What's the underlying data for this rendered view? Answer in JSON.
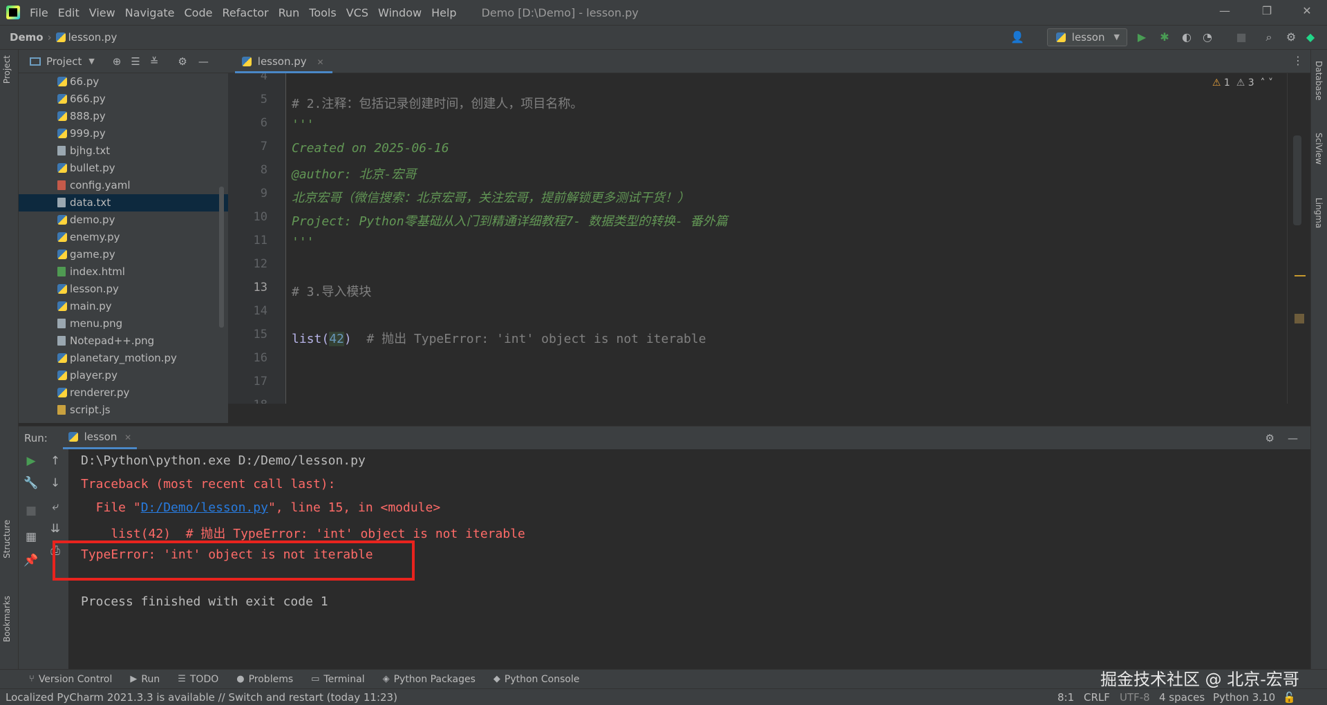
{
  "app": {
    "window_title": "Demo [D:\\Demo] - lesson.py",
    "menu": [
      "File",
      "Edit",
      "View",
      "Navigate",
      "Code",
      "Refactor",
      "Run",
      "Tools",
      "VCS",
      "Window",
      "Help"
    ]
  },
  "breadcrumb": {
    "project": "Demo",
    "file": "lesson.py"
  },
  "toolbar": {
    "run_config": "lesson"
  },
  "project_panel": {
    "title": "Project",
    "files": [
      {
        "name": "66.py",
        "type": "py"
      },
      {
        "name": "666.py",
        "type": "py"
      },
      {
        "name": "888.py",
        "type": "py"
      },
      {
        "name": "999.py",
        "type": "py"
      },
      {
        "name": "bjhg.txt",
        "type": "txt"
      },
      {
        "name": "bullet.py",
        "type": "py"
      },
      {
        "name": "config.yaml",
        "type": "yaml"
      },
      {
        "name": "data.txt",
        "type": "txt",
        "selected": true
      },
      {
        "name": "demo.py",
        "type": "py"
      },
      {
        "name": "enemy.py",
        "type": "py"
      },
      {
        "name": "game.py",
        "type": "py"
      },
      {
        "name": "index.html",
        "type": "html"
      },
      {
        "name": "lesson.py",
        "type": "py"
      },
      {
        "name": "main.py",
        "type": "py"
      },
      {
        "name": "menu.png",
        "type": "png"
      },
      {
        "name": "Notepad++.png",
        "type": "png"
      },
      {
        "name": "planetary_motion.py",
        "type": "py"
      },
      {
        "name": "player.py",
        "type": "py"
      },
      {
        "name": "renderer.py",
        "type": "py"
      },
      {
        "name": "script.js",
        "type": "js"
      }
    ]
  },
  "editor": {
    "tab": "lesson.py",
    "warnings": "1",
    "weak_warnings": "3",
    "line_numbers": [
      "4",
      "5",
      "6",
      "7",
      "8",
      "9",
      "10",
      "11",
      "12",
      "13",
      "14",
      "15",
      "16",
      "17",
      "18"
    ],
    "current_line": "13",
    "lines": {
      "l5": "# 2.注释：包括记录创建时间，创建人，项目名称。",
      "l6": "'''",
      "l7": "Created on 2025-06-16",
      "l8": "@author: 北京-宏哥",
      "l9": "北京宏哥（微信搜索：北京宏哥，关注宏哥，提前解锁更多测试干货！）",
      "l10": "Project: Python零基础从入门到精通详细教程7- 数据类型的转换- 番外篇",
      "l11": "'''",
      "l13": "# 3.导入模块",
      "l15_fn": "list(",
      "l15_num": "42",
      "l15_close": ")",
      "l15_comment": "  # 抛出 TypeError: 'int' object is not iterable"
    }
  },
  "run_panel": {
    "label": "Run:",
    "tab": "lesson",
    "output": {
      "cmd": "D:\\Python\\python.exe D:/Demo/lesson.py",
      "traceback": "Traceback (most recent call last):",
      "file_prefix": "  File \"",
      "file_link": "D:/Demo/lesson.py",
      "file_suffix": "\", line 15, in <module>",
      "code": "    list(42)  # 抛出 TypeError: 'int' object is not iterable",
      "error": "TypeError: 'int' object is not iterable",
      "finished": "Process finished with exit code 1"
    }
  },
  "bottom_tabs": [
    "Version Control",
    "Run",
    "TODO",
    "Problems",
    "Terminal",
    "Python Packages",
    "Python Console"
  ],
  "side_tabs": {
    "left_top": "Project",
    "left_mid": "Structure",
    "left_bot": "Bookmarks",
    "right": [
      "Database",
      "SciView",
      "Lingma"
    ]
  },
  "status_bar": {
    "message": "Localized PyCharm 2021.3.3 is available // Switch and restart (today 11:23)",
    "position": "8:1",
    "line_sep": "CRLF",
    "encoding": "UTF-8",
    "indent": "4 spaces",
    "interpreter": "Python 3.10"
  },
  "watermark": "掘金技术社区 @ 北京-宏哥"
}
